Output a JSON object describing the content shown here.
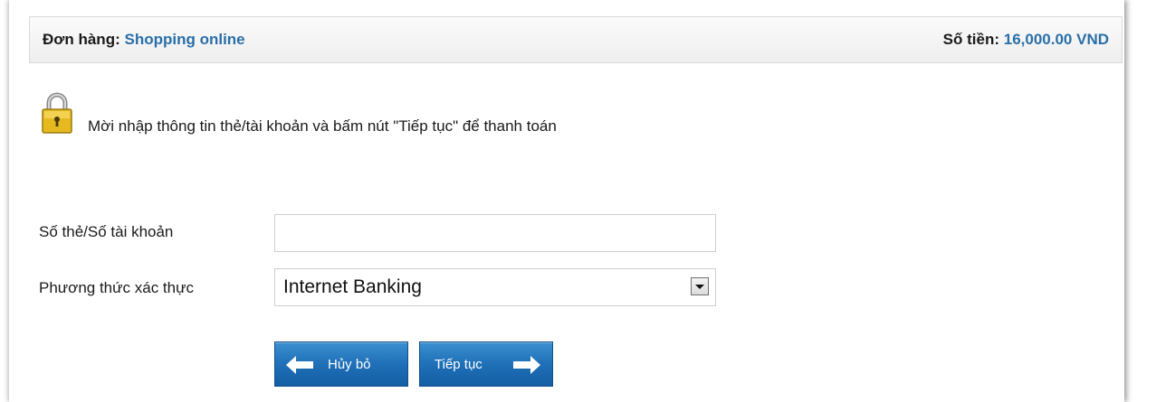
{
  "header": {
    "order_label": "Đơn hàng:",
    "order_value": "Shopping online",
    "amount_label": "Số tiền:",
    "amount_value": "16,000.00 VND"
  },
  "notice": {
    "icon": "lock-icon",
    "text": "Mời nhập thông tin thẻ/tài khoản và bấm nút \"Tiếp tục\" để thanh toán"
  },
  "form": {
    "card_label": "Số thẻ/Số tài khoản",
    "card_value": "",
    "method_label": "Phương thức xác thực",
    "method_selected": "Internet Banking"
  },
  "buttons": {
    "cancel_label": "Hủy bỏ",
    "next_label": "Tiếp tục"
  },
  "colors": {
    "accent_text": "#2a6fa8",
    "button_blue": "#1f70b8"
  }
}
